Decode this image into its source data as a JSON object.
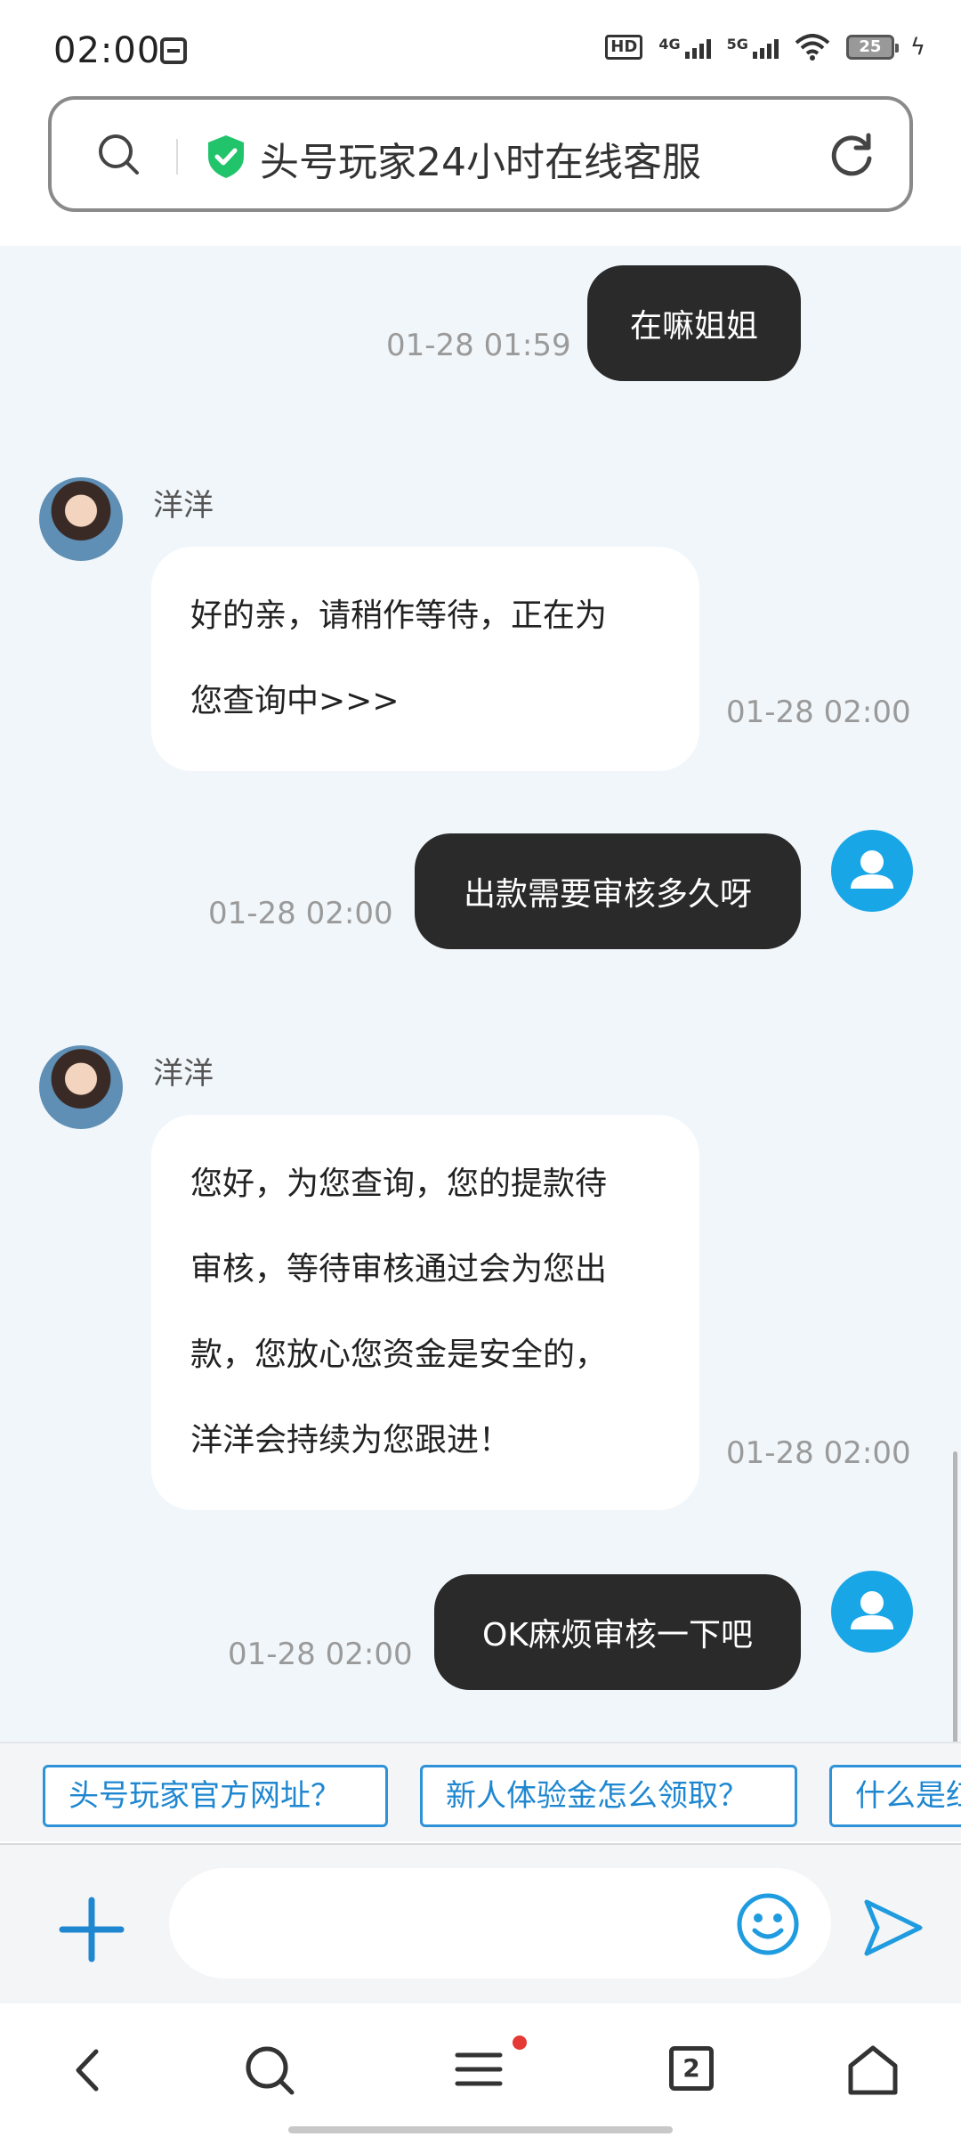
{
  "status_bar": {
    "time": "02:00",
    "hd_label": "HD",
    "network_1": "4G",
    "network_2": "5G",
    "battery": "25"
  },
  "address_bar": {
    "title": "头号玩家24小时在线客服"
  },
  "conversation": {
    "agent_name": "洋洋",
    "messages": [
      {
        "sender": "user",
        "text": "在嘛姐姐",
        "time": "01-28 01:59"
      },
      {
        "sender": "agent",
        "lines": [
          "好的亲，请稍作等待，正在为",
          "您查询中>>>"
        ],
        "time": "01-28 02:00"
      },
      {
        "sender": "user",
        "text": "出款需要审核多久呀",
        "time": "01-28 02:00"
      },
      {
        "sender": "agent",
        "lines": [
          "您好，为您查询，您的提款待",
          "审核，等待审核通过会为您出",
          "款，您放心您资金是安全的，",
          "洋洋会持续为您跟进！"
        ],
        "time": "01-28 02:00"
      },
      {
        "sender": "user",
        "text": "OK麻烦审核一下吧",
        "time": "01-28 02:00"
      }
    ]
  },
  "quick_replies": [
    "头号玩家官方网址？",
    "新人体验金怎么领取？",
    "什么是红"
  ],
  "input": {
    "placeholder": ""
  },
  "nav": {
    "tabs_count": "2"
  },
  "colors": {
    "accent": "#1f87d0",
    "user_bubble": "#2a2a2a",
    "chat_bg": "#f1f6fa",
    "avatar_blue": "#19a6e6"
  }
}
